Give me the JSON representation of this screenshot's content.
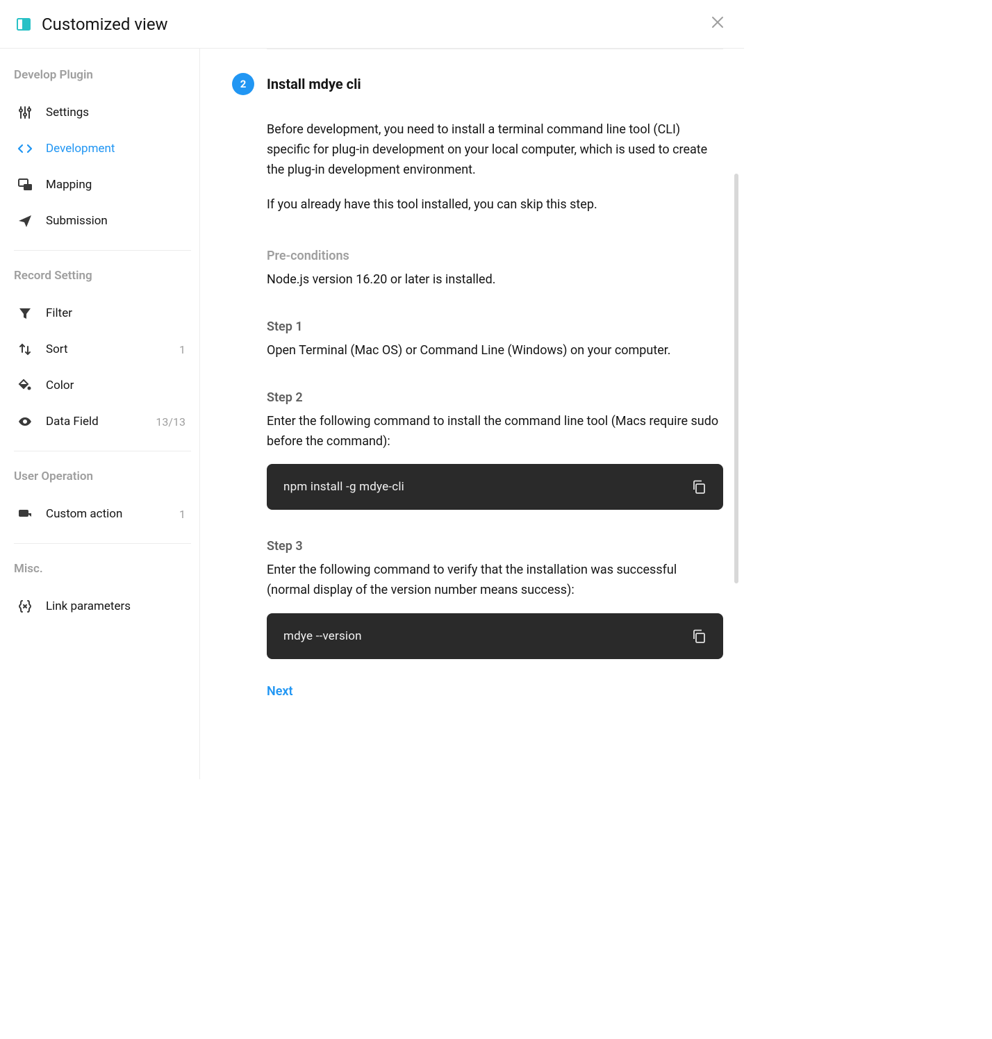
{
  "header": {
    "title": "Customized view"
  },
  "sidebar": {
    "sections": [
      {
        "title": "Develop Plugin",
        "items": [
          {
            "label": "Settings",
            "active": false
          },
          {
            "label": "Development",
            "active": true
          },
          {
            "label": "Mapping",
            "active": false
          },
          {
            "label": "Submission",
            "active": false
          }
        ]
      },
      {
        "title": "Record Setting",
        "items": [
          {
            "label": "Filter",
            "badge": ""
          },
          {
            "label": "Sort",
            "badge": "1"
          },
          {
            "label": "Color",
            "badge": ""
          },
          {
            "label": "Data Field",
            "badge": "13/13"
          }
        ]
      },
      {
        "title": "User Operation",
        "items": [
          {
            "label": "Custom action",
            "badge": "1"
          }
        ]
      },
      {
        "title": "Misc.",
        "items": [
          {
            "label": "Link parameters",
            "badge": ""
          }
        ]
      }
    ]
  },
  "main": {
    "step_number": "2",
    "step_title": "Install mdye cli",
    "paragraphs": [
      "Before development, you need to install a terminal command line tool (CLI) specific for plug-in development on your local computer, which is used to create the plug-in development environment.",
      "If you already have this tool installed, you can skip this step."
    ],
    "preconditions_label": "Pre-conditions",
    "preconditions_body": "Node.js version 16.20 or later is installed.",
    "steps": [
      {
        "label": "Step 1",
        "body": "Open Terminal (Mac OS) or Command Line (Windows) on your computer."
      },
      {
        "label": "Step 2",
        "body": "Enter the following command to install the command line tool (Macs require sudo before the command):",
        "code": "npm install -g mdye-cli"
      },
      {
        "label": "Step 3",
        "body": "Enter the following command to verify that the installation was successful (normal display of the version number means success):",
        "code": "mdye --version"
      }
    ],
    "next_label": "Next"
  }
}
